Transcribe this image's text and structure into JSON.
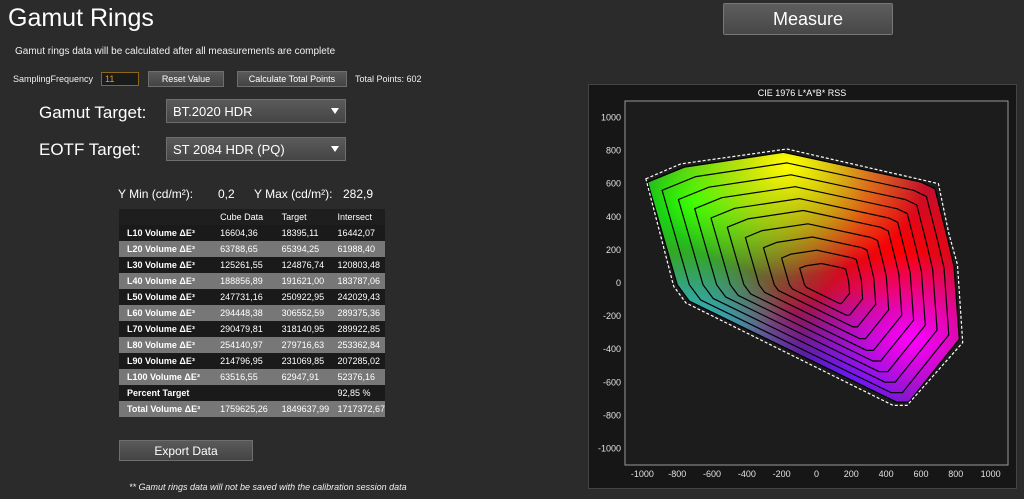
{
  "title": "Gamut Rings",
  "measure_label": "Measure",
  "info_text": "Gamut rings data will be calculated after all measurements are complete",
  "sampling": {
    "label": "SamplingFrequency",
    "value": "11",
    "reset_label": "Reset Value",
    "calculate_label": "Calculate Total Points",
    "total_points": "Total Points: 602"
  },
  "gamut_target": {
    "label": "Gamut Target:",
    "value": "BT.2020 HDR"
  },
  "eotf_target": {
    "label": "EOTF Target:",
    "value": "ST 2084 HDR (PQ)"
  },
  "luminance": {
    "ymin_label": "Y Min (cd/m²):",
    "ymin_value": "0,2",
    "ymax_label": "Y Max (cd/m²):",
    "ymax_value": "282,9"
  },
  "table": {
    "columns": [
      "",
      "Cube Data",
      "Target",
      "Intersect"
    ],
    "rows": [
      [
        "L10 Volume ΔE³",
        "16604,36",
        "18395,11",
        "16442,07"
      ],
      [
        "L20 Volume ΔE³",
        "63788,65",
        "65394,25",
        "61988,40"
      ],
      [
        "L30 Volume ΔE³",
        "125261,55",
        "124876,74",
        "120803,48"
      ],
      [
        "L40 Volume ΔE³",
        "188856,89",
        "191621,00",
        "183787,06"
      ],
      [
        "L50 Volume ΔE³",
        "247731,16",
        "250922,95",
        "242029,43"
      ],
      [
        "L60 Volume ΔE³",
        "294448,38",
        "306552,59",
        "289375,36"
      ],
      [
        "L70 Volume ΔE³",
        "290479,81",
        "318140,95",
        "289922,85"
      ],
      [
        "L80 Volume ΔE³",
        "254140,97",
        "279716,63",
        "253362,84"
      ],
      [
        "L90 Volume ΔE³",
        "214796,95",
        "231069,85",
        "207285,02"
      ],
      [
        "L100 Volume ΔE³",
        "63516,55",
        "62947,91",
        "52376,16"
      ],
      [
        "Percent Target",
        "",
        "",
        "92,85 %"
      ],
      [
        "Total Volume ΔE³",
        "1759625,26",
        "1849637,99",
        "1717372,67"
      ]
    ]
  },
  "export_label": "Export Data",
  "footnote": "** Gamut rings data will not be saved with the calibration session data",
  "chart_data": {
    "type": "scatter",
    "title": "CIE 1976 L*A*B* RSS",
    "xlim": [
      -1100,
      1100
    ],
    "ylim": [
      -1100,
      1100
    ],
    "x_ticks": [
      -1000,
      -800,
      -600,
      -400,
      -200,
      0,
      200,
      400,
      600,
      800,
      1000
    ],
    "y_ticks": [
      -1000,
      -800,
      -600,
      -400,
      -200,
      0,
      200,
      400,
      600,
      800,
      1000
    ],
    "target_boundary": [
      [
        -980,
        630
      ],
      [
        -780,
        720
      ],
      [
        -170,
        810
      ],
      [
        620,
        620
      ],
      [
        700,
        600
      ],
      [
        760,
        300
      ],
      [
        810,
        110
      ],
      [
        840,
        -360
      ],
      [
        520,
        -740
      ],
      [
        440,
        -740
      ],
      [
        -750,
        -120
      ],
      [
        -820,
        -20
      ]
    ],
    "gamut_boundary": [
      [
        -970,
        610
      ],
      [
        -760,
        700
      ],
      [
        -190,
        790
      ],
      [
        600,
        610
      ],
      [
        680,
        570
      ],
      [
        750,
        280
      ],
      [
        790,
        100
      ],
      [
        820,
        -340
      ],
      [
        530,
        -720
      ],
      [
        460,
        -720
      ],
      [
        -730,
        -110
      ],
      [
        -800,
        -10
      ]
    ],
    "ring_scales": [
      1.0,
      0.92,
      0.83,
      0.74,
      0.65,
      0.56,
      0.46,
      0.36,
      0.26,
      0.16
    ],
    "ring_center": [
      70,
      -10
    ]
  }
}
